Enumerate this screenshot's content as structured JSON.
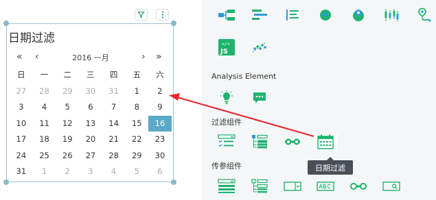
{
  "widget": {
    "title": "日期过滤",
    "nav_prev_year": "«",
    "nav_prev_month": "‹",
    "nav_next_month": "›",
    "nav_next_year": "»",
    "month_label": "2016 一月",
    "weekdays": [
      "日",
      "一",
      "二",
      "三",
      "四",
      "五",
      "六"
    ],
    "weeks": [
      [
        "27",
        "28",
        "29",
        "30",
        "31",
        "1",
        "2"
      ],
      [
        "3",
        "4",
        "5",
        "6",
        "7",
        "8",
        "9"
      ],
      [
        "10",
        "11",
        "12",
        "13",
        "14",
        "15",
        "16"
      ],
      [
        "17",
        "18",
        "19",
        "20",
        "21",
        "22",
        "23"
      ],
      [
        "24",
        "25",
        "26",
        "27",
        "28",
        "29",
        "30"
      ],
      [
        "31",
        "1",
        "2",
        "3",
        "4",
        "5",
        "6"
      ]
    ],
    "selected_date": "16",
    "toolbar_icons": [
      "filter-icon",
      "more-vertical-icon"
    ]
  },
  "palette": {
    "accent": "#5aa9c8",
    "green": "#1fb36e",
    "red_arrow": "#e8272e",
    "panel_bg": "#f5f6f7"
  },
  "panel": {
    "row1_icons": [
      "tree-chart-icon",
      "horizontal-bar-icon",
      "list-bar-icon",
      "globe-icon",
      "map-pin-icon",
      "candlestick-icon",
      "route-map-icon"
    ],
    "row2_icons": [
      "js-icon",
      "scatter-icon"
    ],
    "sections": {
      "analysis": "Analysis Element",
      "filters": "过滤组件",
      "params": "传参组件"
    },
    "analysis_icons": [
      "insight-bulb-icon",
      "comment-icon"
    ],
    "filter_icons": [
      "checklist-icon",
      "tree-filter-icon",
      "range-slider-icon",
      "calendar-icon"
    ],
    "param_icons": [
      "list-param-icon",
      "tree-param-icon",
      "dropdown-param-icon",
      "text-input-param-icon",
      "range-param-icon",
      "search-param-icon"
    ],
    "tooltip": "日期过滤"
  }
}
